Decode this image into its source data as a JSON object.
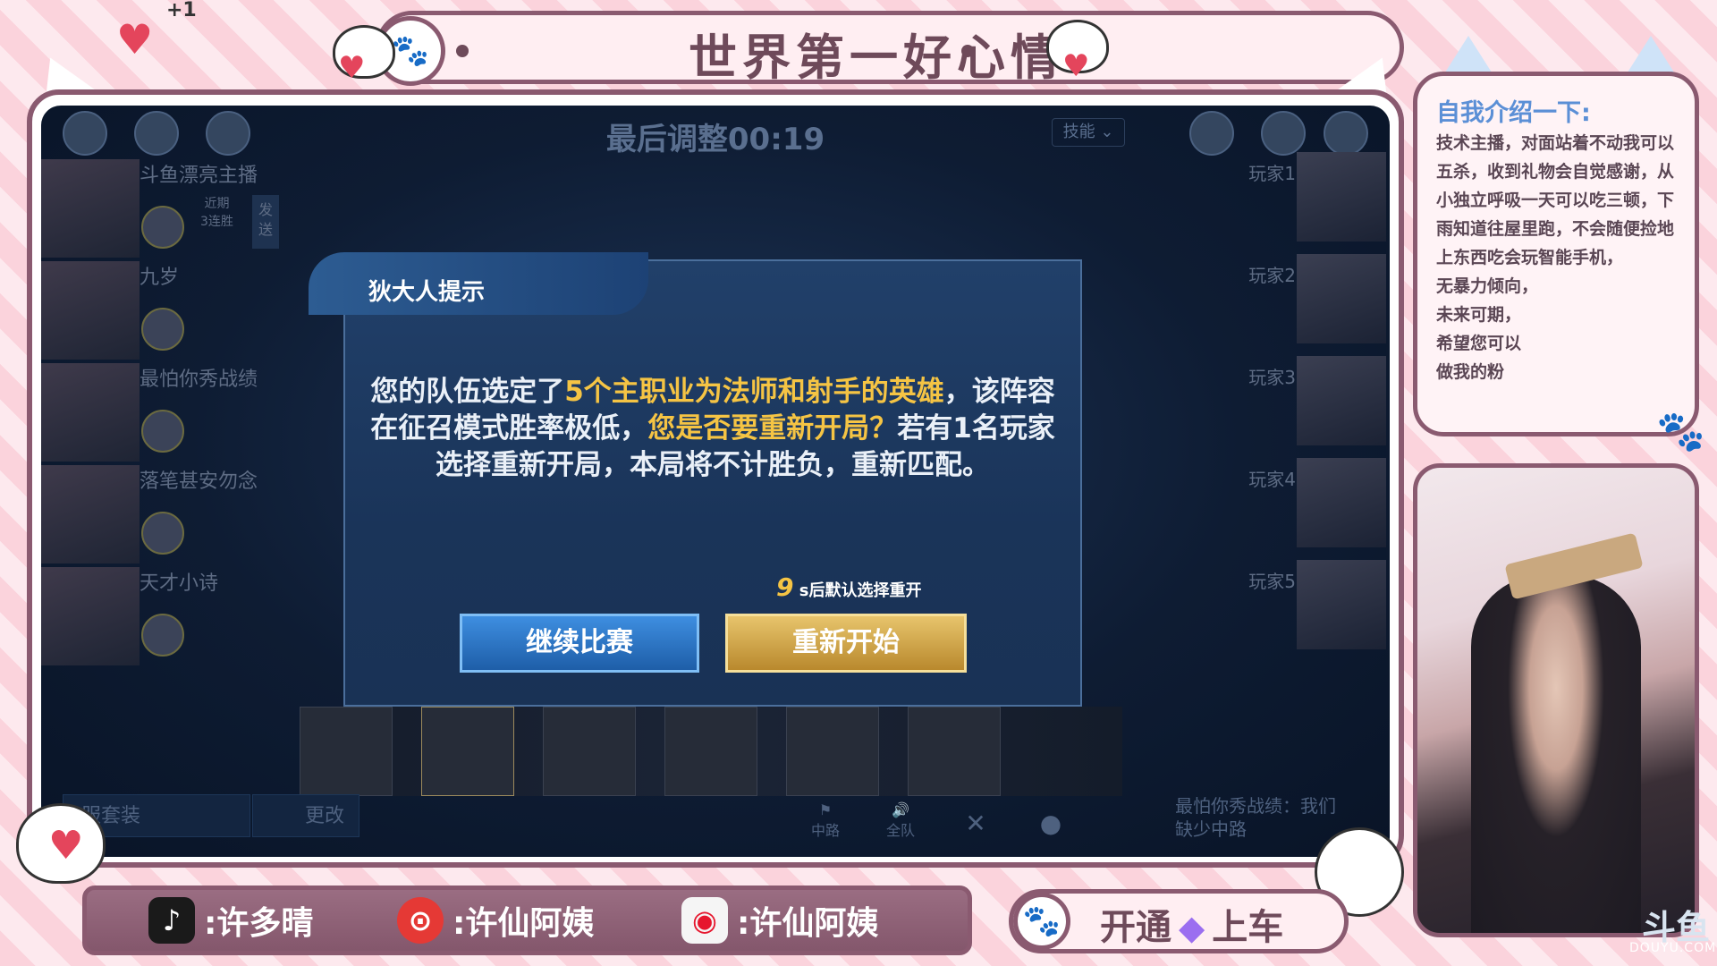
{
  "banner": {
    "title": "世界第一好心情",
    "plus_one": "+1"
  },
  "game": {
    "timer": "最后调整00:19",
    "skill_button": "技能",
    "players": [
      {
        "name": "斗鱼漂亮主播",
        "streak_line1": "近期",
        "streak_line2": "3连胜",
        "send_label": "发送"
      },
      {
        "name": "九岁"
      },
      {
        "name": "最怕你秀战绩"
      },
      {
        "name": "落笔甚安勿念"
      },
      {
        "name": "天才小诗"
      }
    ],
    "opponents": [
      "玩家1",
      "玩家2",
      "玩家3",
      "玩家4",
      "玩家5"
    ],
    "bottom": {
      "outfit_label": "服套装",
      "change_label": "更改",
      "mid_label": "中路",
      "team_label": "全队",
      "chat_line1": "最怕你秀战绩：我们",
      "chat_line2": "缺少中路"
    }
  },
  "dialog": {
    "title": "狄大人提示",
    "message_part1": "您的队伍选定了",
    "message_highlight1": "5个主职业为法师和射手的英雄",
    "message_part2": "，该阵容在征召模式胜率极低，",
    "message_highlight2": "您是否要重新开局？",
    "message_part3": "若有1名玩家选择重新开局，本局将不计胜负，重新匹配。",
    "countdown_number": "9",
    "countdown_text": "s后默认选择重开",
    "continue_button": "继续比赛",
    "restart_button": "重新开始"
  },
  "intro": {
    "title": "自我介绍一下:",
    "lines": [
      "技术主播，对面站着不动我可以五杀，收到礼物会自觉感谢，从小独立呼吸一天可以吃三顿，下雨知道往屋里跑，不会随便捡地上东西吃会玩智能手机，",
      "无暴力倾向，",
      "未来可期，",
      "希望您可以",
      "做我的粉"
    ]
  },
  "social": {
    "douyin": ":许多晴",
    "netease": ":许仙阿姨",
    "weibo": ":许仙阿姨"
  },
  "subscribe": {
    "text_left": "开通",
    "text_right": "上车"
  },
  "watermark": "DOUYU.COM",
  "colors": {
    "frame": "#8a5a70",
    "accent_pink": "#fbd3dc",
    "gold": "#f5c444",
    "intro_blue": "#5b8fd6"
  }
}
